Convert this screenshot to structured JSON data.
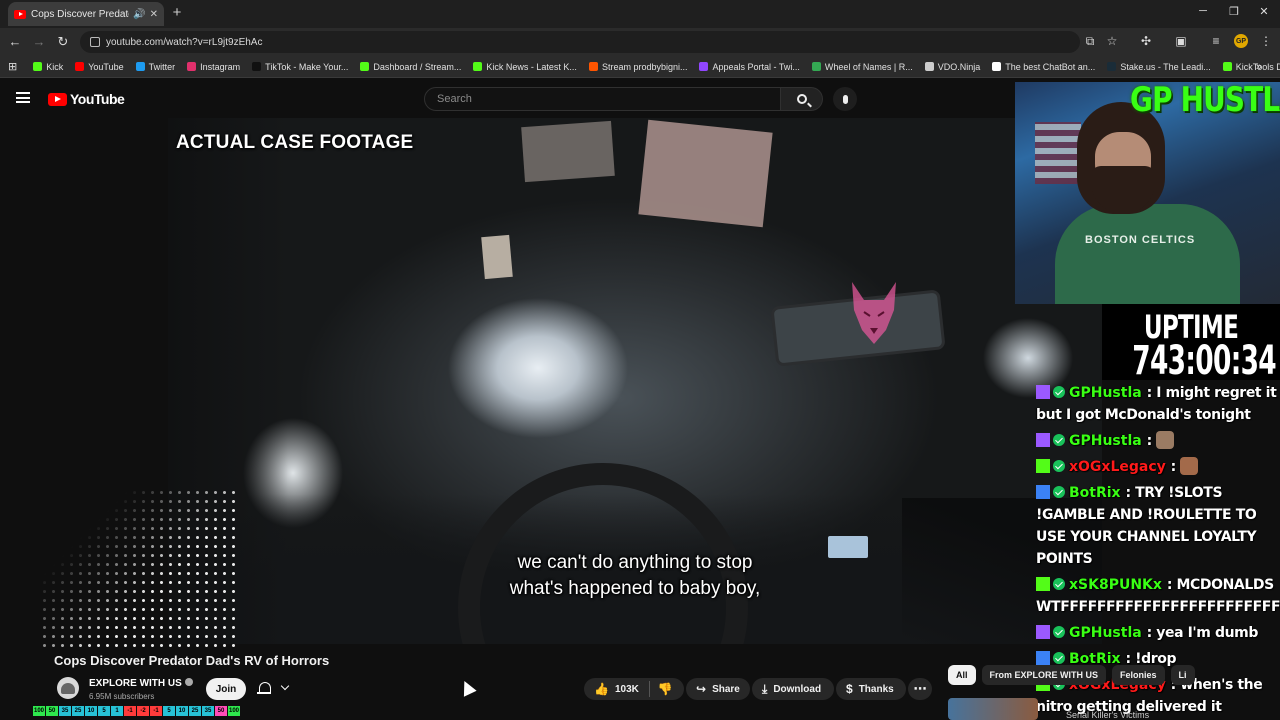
{
  "browser": {
    "tab_title": "Cops Discover Predator Dad's RV of Horrors",
    "url": "youtube.com/watch?v=rL9jt9zEhAc",
    "bookmarks": [
      {
        "label": "Kick",
        "color": "#53fc18"
      },
      {
        "label": "YouTube",
        "color": "#ff0000"
      },
      {
        "label": "Twitter",
        "color": "#1d9bf0"
      },
      {
        "label": "Instagram",
        "color": "#e1306c"
      },
      {
        "label": "TikTok - Make Your...",
        "color": "#111111"
      },
      {
        "label": "Dashboard / Stream...",
        "color": "#53fc18"
      },
      {
        "label": "Kick News - Latest K...",
        "color": "#53fc18"
      },
      {
        "label": "Stream prodbybigni...",
        "color": "#ff5500"
      },
      {
        "label": "Appeals Portal - Twi...",
        "color": "#9146ff"
      },
      {
        "label": "Wheel of Names | R...",
        "color": "#34a853"
      },
      {
        "label": "VDO.Ninja",
        "color": "#cccccc"
      },
      {
        "label": "The best ChatBot an...",
        "color": "#ffffff"
      },
      {
        "label": "Stake.us - The Leadi...",
        "color": "#1a2c38"
      },
      {
        "label": "KickTools Dashboard",
        "color": "#53fc18"
      }
    ]
  },
  "youtube": {
    "logo_text": "YouTube",
    "search_placeholder": "Search"
  },
  "video": {
    "overlay_tag": "ACTUAL CASE FOOTAGE",
    "subtitle_line1": "we can't do anything to stop",
    "subtitle_line2": "what's happened to baby boy,",
    "title": "Cops Discover Predator Dad's RV of Horrors",
    "channel_name": "EXPLORE WITH US",
    "subscribers": "6.95M subscribers",
    "join_label": "Join",
    "likes": "103K",
    "share_label": "Share",
    "download_label": "Download",
    "thanks_label": "Thanks"
  },
  "recommendations": {
    "chips": [
      "All",
      "From EXPLORE WITH US",
      "Felonies",
      "Li"
    ],
    "active_chip": "All",
    "first_title": "Serial Killer's Victims"
  },
  "stream": {
    "streamer_name": "GP HUSTLA",
    "uptime_label": "UPTIME",
    "uptime_value": "743:00:34",
    "shirt_text": "BOSTON CELTICS",
    "chat": [
      {
        "user": "GPHustla",
        "user_color": "#39ff14",
        "badge_color": "#9b59ff",
        "text": ": I might regret it but I got McDonald's tonight"
      },
      {
        "user": "GPHustla",
        "user_color": "#39ff14",
        "badge_color": "#9b59ff",
        "text": ":"
      },
      {
        "user": "xOGxLegacy",
        "user_color": "#ff1a1a",
        "badge_color": "#53fc18",
        "text": ":"
      },
      {
        "user": "BotRix",
        "user_color": "#39ff14",
        "badge_color": "#3b82f6",
        "text": ": TRY !SLOTS !GAMBLE AND !ROULETTE TO USE YOUR CHANNEL LOYALTY POINTS"
      },
      {
        "user": "xSK8PUNKx",
        "user_color": "#39ff14",
        "badge_color": "#53fc18",
        "text": ": MCDONALDS WTFFFFFFFFFFFFFFFFFFFFFFFFF"
      },
      {
        "user": "GPHustla",
        "user_color": "#39ff14",
        "badge_color": "#9b59ff",
        "text": ": yea I'm dumb"
      },
      {
        "user": "BotRix",
        "user_color": "#39ff14",
        "badge_color": "#3b82f6",
        "text": ": !drop"
      },
      {
        "user": "xOGxLegacy",
        "user_color": "#ff1a1a",
        "badge_color": "#53fc18",
        "text": ": when's the nitro getting delivered it doesn't show me"
      }
    ],
    "prediction_values": [
      "100",
      "50",
      "35",
      "25",
      "10",
      "5",
      "1",
      "-1",
      "-2",
      "-1",
      "5",
      "10",
      "25",
      "35",
      "50",
      "100"
    ]
  }
}
